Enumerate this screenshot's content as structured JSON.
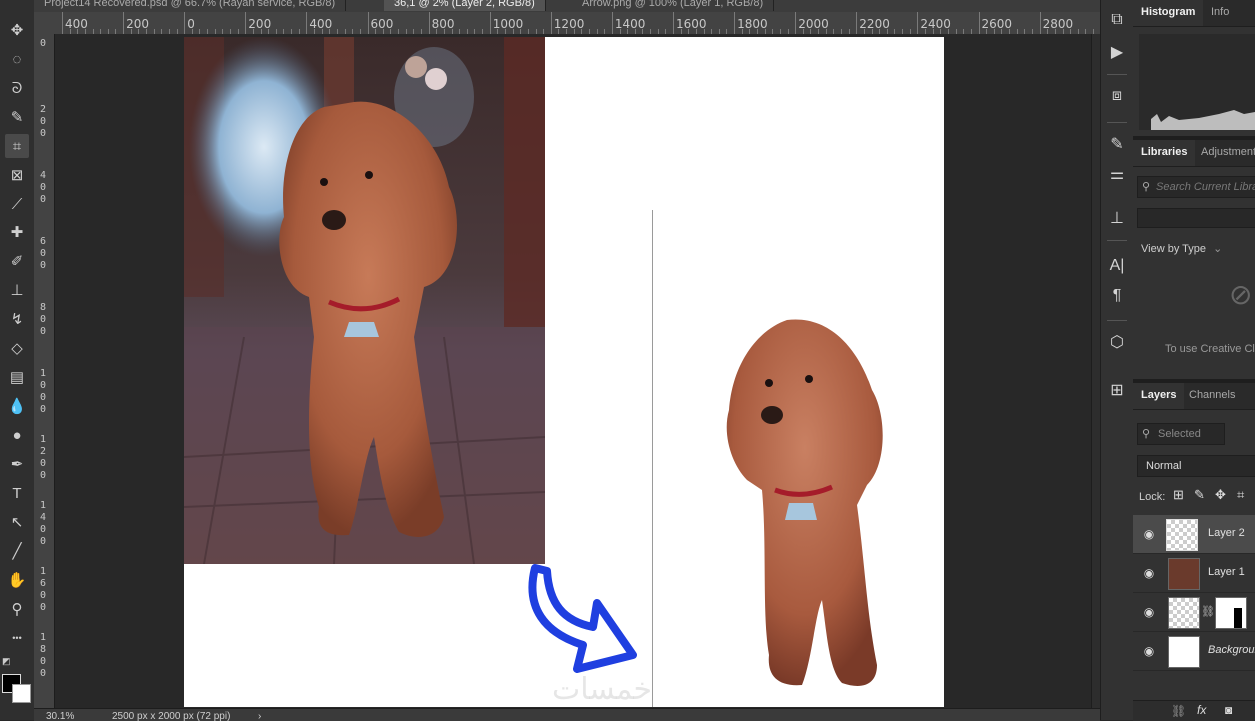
{
  "tabs": [
    {
      "label": "Project14 Recovered.psd @ 66.7% (Rayan service, RGB/8)",
      "active": false
    },
    {
      "label": "36,1 @ 2% (Layer 2, RGB/8)",
      "active": true
    },
    {
      "label": "Arrow.png @ 100% (Layer 1, RGB/8)",
      "active": false
    }
  ],
  "ruler": {
    "h_labels": [
      "400",
      "200",
      "0",
      "200",
      "400",
      "600",
      "800",
      "1000",
      "1200",
      "1400",
      "1600",
      "1800",
      "2000",
      "2200",
      "2400",
      "2600",
      "2800"
    ],
    "v_labels": [
      "0",
      "2\n0\n0",
      "4\n0\n0",
      "6\n0\n0",
      "8\n0\n0",
      "1\n0\n0\n0",
      "1\n2\n0\n0",
      "1\n4\n0\n0",
      "1\n6\n0\n0",
      "1\n8\n0\n0"
    ]
  },
  "tools": [
    {
      "icon": "move-icon",
      "glyph": "✥"
    },
    {
      "icon": "marquee-icon",
      "glyph": "◌"
    },
    {
      "icon": "lasso-icon",
      "glyph": "ᘐ"
    },
    {
      "icon": "quick-select-icon",
      "glyph": "✎"
    },
    {
      "icon": "crop-icon",
      "glyph": "⌗"
    },
    {
      "icon": "frame-icon",
      "glyph": "⊠"
    },
    {
      "icon": "eyedropper-icon",
      "glyph": "⟋"
    },
    {
      "icon": "healing-brush-icon",
      "glyph": "✚"
    },
    {
      "icon": "brush-icon",
      "glyph": "✐"
    },
    {
      "icon": "clone-stamp-icon",
      "glyph": "⊥"
    },
    {
      "icon": "history-brush-icon",
      "glyph": "↯"
    },
    {
      "icon": "eraser-icon",
      "glyph": "◇"
    },
    {
      "icon": "gradient-icon",
      "glyph": "▤"
    },
    {
      "icon": "blur-icon",
      "glyph": "💧"
    },
    {
      "icon": "dodge-icon",
      "glyph": "●"
    },
    {
      "icon": "pen-icon",
      "glyph": "✒"
    },
    {
      "icon": "type-icon",
      "glyph": "T"
    },
    {
      "icon": "path-select-icon",
      "glyph": "↖"
    },
    {
      "icon": "line-icon",
      "glyph": "╱"
    },
    {
      "icon": "hand-icon",
      "glyph": "✋"
    },
    {
      "icon": "zoom-icon",
      "glyph": "⚲"
    },
    {
      "icon": "more-tools-icon",
      "glyph": "•••"
    }
  ],
  "status": {
    "zoom": "30.1%",
    "doc_info": "2500 px x 2000 px (72 ppi)",
    "arrow": "›"
  },
  "watermark": "خمسات",
  "panel_icons": [
    "history-icon",
    "play-actions-icon",
    "plugins-icon",
    "brush-settings-icon",
    "adjust-icon",
    "clone-source-icon",
    "character-icon",
    "paragraph-icon",
    "3d-icon",
    "grid-icon"
  ],
  "panels": {
    "histogram": {
      "tabs": [
        "Histogram",
        "Info"
      ]
    },
    "libraries": {
      "tabs": [
        "Libraries",
        "Adjustments"
      ],
      "search_placeholder": "Search Current Library",
      "view_by": "View by Type",
      "cloud_message": "To use Creative Cloud"
    },
    "layers": {
      "tabs": [
        "Layers",
        "Channels"
      ],
      "filter": "Selected",
      "blend_mode": "Normal",
      "lock_label": "Lock:",
      "items": [
        {
          "name": "Layer 2",
          "selected": true
        },
        {
          "name": "Layer 1",
          "selected": false
        },
        {
          "name": "",
          "selected": false
        },
        {
          "name": "Background",
          "selected": false
        }
      ]
    }
  },
  "colors": {
    "accent_arrow": "#1f3fe0",
    "panel_bg": "#323232",
    "canvas_bg": "#282828"
  }
}
